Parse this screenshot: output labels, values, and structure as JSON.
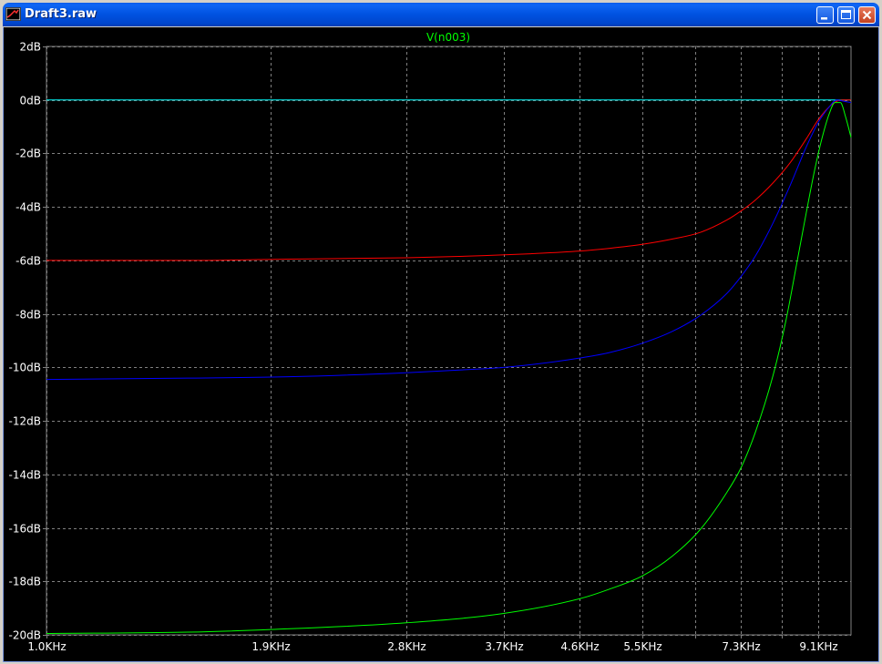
{
  "window": {
    "title": "Draft3.raw"
  },
  "colors": {
    "background": "#000000",
    "grid": "#808080",
    "label": "#ffffff",
    "trace_title": "#00ff00"
  },
  "chart_data": {
    "type": "line",
    "title": "V(n003)",
    "xscale": "log",
    "xlim_hz": [
      1000,
      10000
    ],
    "ylim_db": [
      -20,
      2
    ],
    "grid": true,
    "x_ticks": [
      {
        "value": 1000,
        "label": "1.0KHz",
        "labeled": true
      },
      {
        "value": 1900,
        "label": "1.9KHz",
        "labeled": true
      },
      {
        "value": 2800,
        "label": "2.8KHz",
        "labeled": true
      },
      {
        "value": 3700,
        "label": "3.7KHz",
        "labeled": true
      },
      {
        "value": 4600,
        "label": "4.6KHz",
        "labeled": true
      },
      {
        "value": 5500,
        "label": "5.5KHz",
        "labeled": true
      },
      {
        "value": 6400,
        "label": "",
        "labeled": false
      },
      {
        "value": 7300,
        "label": "7.3KHz",
        "labeled": true
      },
      {
        "value": 8200,
        "label": "",
        "labeled": false
      },
      {
        "value": 9100,
        "label": "9.1KHz",
        "labeled": true
      }
    ],
    "y_ticks": [
      {
        "value": 2,
        "label": "2dB"
      },
      {
        "value": 0,
        "label": "0dB"
      },
      {
        "value": -2,
        "label": "-2dB"
      },
      {
        "value": -4,
        "label": "-4dB"
      },
      {
        "value": -6,
        "label": "-6dB"
      },
      {
        "value": -8,
        "label": "-8dB"
      },
      {
        "value": -10,
        "label": "-10dB"
      },
      {
        "value": -12,
        "label": "-12dB"
      },
      {
        "value": -14,
        "label": "-14dB"
      },
      {
        "value": -16,
        "label": "-16dB"
      },
      {
        "value": -18,
        "label": "-18dB"
      },
      {
        "value": -20,
        "label": "-20dB"
      }
    ],
    "series": [
      {
        "color": "#00ffff",
        "x": [
          1000,
          2000,
          4000,
          6000,
          8000,
          10000
        ],
        "y": [
          0,
          0,
          0,
          0,
          0,
          0
        ]
      },
      {
        "color": "#ff0000",
        "x": [
          1000,
          1500,
          2000,
          2800,
          3500,
          4000,
          4600,
          5000,
          5500,
          6000,
          6500,
          7000,
          7300,
          7600,
          8000,
          8400,
          8800,
          9100,
          9400,
          9600,
          9800,
          10000
        ],
        "y": [
          -6.0,
          -6.0,
          -5.95,
          -5.9,
          -5.82,
          -5.75,
          -5.65,
          -5.55,
          -5.4,
          -5.2,
          -4.95,
          -4.5,
          -4.15,
          -3.75,
          -3.1,
          -2.35,
          -1.45,
          -0.75,
          -0.25,
          -0.05,
          0.0,
          0.0
        ]
      },
      {
        "color": "#0000ff",
        "x": [
          1000,
          1500,
          2000,
          2800,
          3500,
          3700,
          4000,
          4600,
          5000,
          5500,
          6000,
          6500,
          7000,
          7300,
          7600,
          8000,
          8400,
          8800,
          9100,
          9400,
          9600,
          9800,
          10000
        ],
        "y": [
          -10.45,
          -10.4,
          -10.35,
          -10.2,
          -10.05,
          -10.0,
          -9.9,
          -9.65,
          -9.45,
          -9.1,
          -8.65,
          -8.05,
          -7.25,
          -6.6,
          -5.85,
          -4.6,
          -3.2,
          -1.75,
          -0.85,
          -0.25,
          0.0,
          -0.05,
          -0.1
        ]
      },
      {
        "color": "#00ff00",
        "x": [
          1000,
          1500,
          1900,
          2800,
          3700,
          4600,
          5000,
          5500,
          6000,
          6500,
          7000,
          7300,
          7600,
          8000,
          8300,
          8600,
          8800,
          9000,
          9200,
          9400,
          9550,
          9700,
          9850,
          10000
        ],
        "y": [
          -19.95,
          -19.9,
          -19.8,
          -19.55,
          -19.2,
          -18.65,
          -18.3,
          -17.8,
          -17.05,
          -16.05,
          -14.7,
          -13.75,
          -12.45,
          -10.3,
          -8.25,
          -5.8,
          -4.2,
          -2.7,
          -1.45,
          -0.5,
          -0.1,
          -0.1,
          -0.65,
          -1.4
        ]
      }
    ]
  }
}
